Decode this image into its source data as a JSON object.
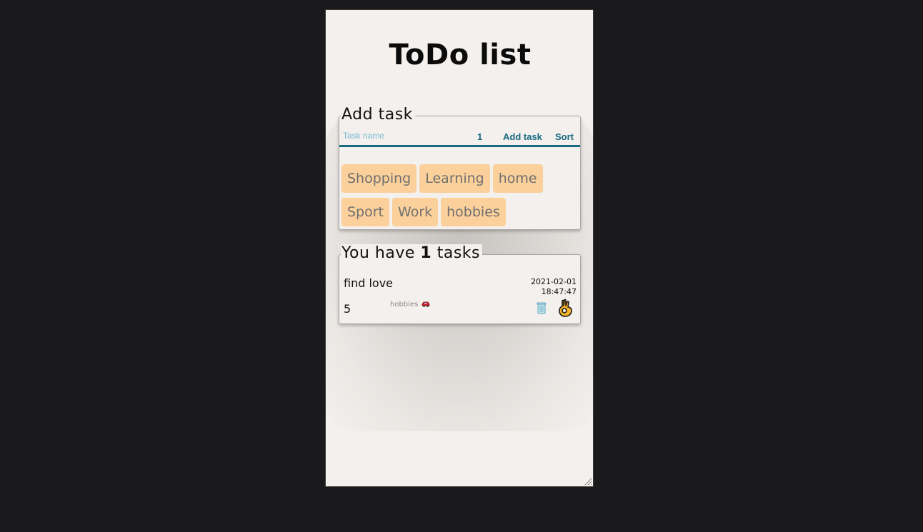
{
  "app": {
    "title": "ToDo list"
  },
  "add_task": {
    "legend": "Add task",
    "input_placeholder": "Task name",
    "priority": "1",
    "add_button": "Add task",
    "sort_button": "Sort",
    "categories": [
      "Shopping",
      "Learning",
      "home",
      "Sport",
      "Work",
      "hobbies"
    ]
  },
  "tasks": {
    "legend_prefix": "You have",
    "count": "1",
    "legend_suffix": "tasks",
    "items": [
      {
        "name": "find love",
        "date": "2021-02-01",
        "time": "18:47:47",
        "priority": "5",
        "category": "hobbies",
        "category_icon": "toy-car-icon"
      }
    ]
  },
  "colors": {
    "accent": "#1a6a82",
    "category_bg": "#fbd09b",
    "panel_bg": "#f3f0ed",
    "outer_bg": "#1a1a1c"
  }
}
